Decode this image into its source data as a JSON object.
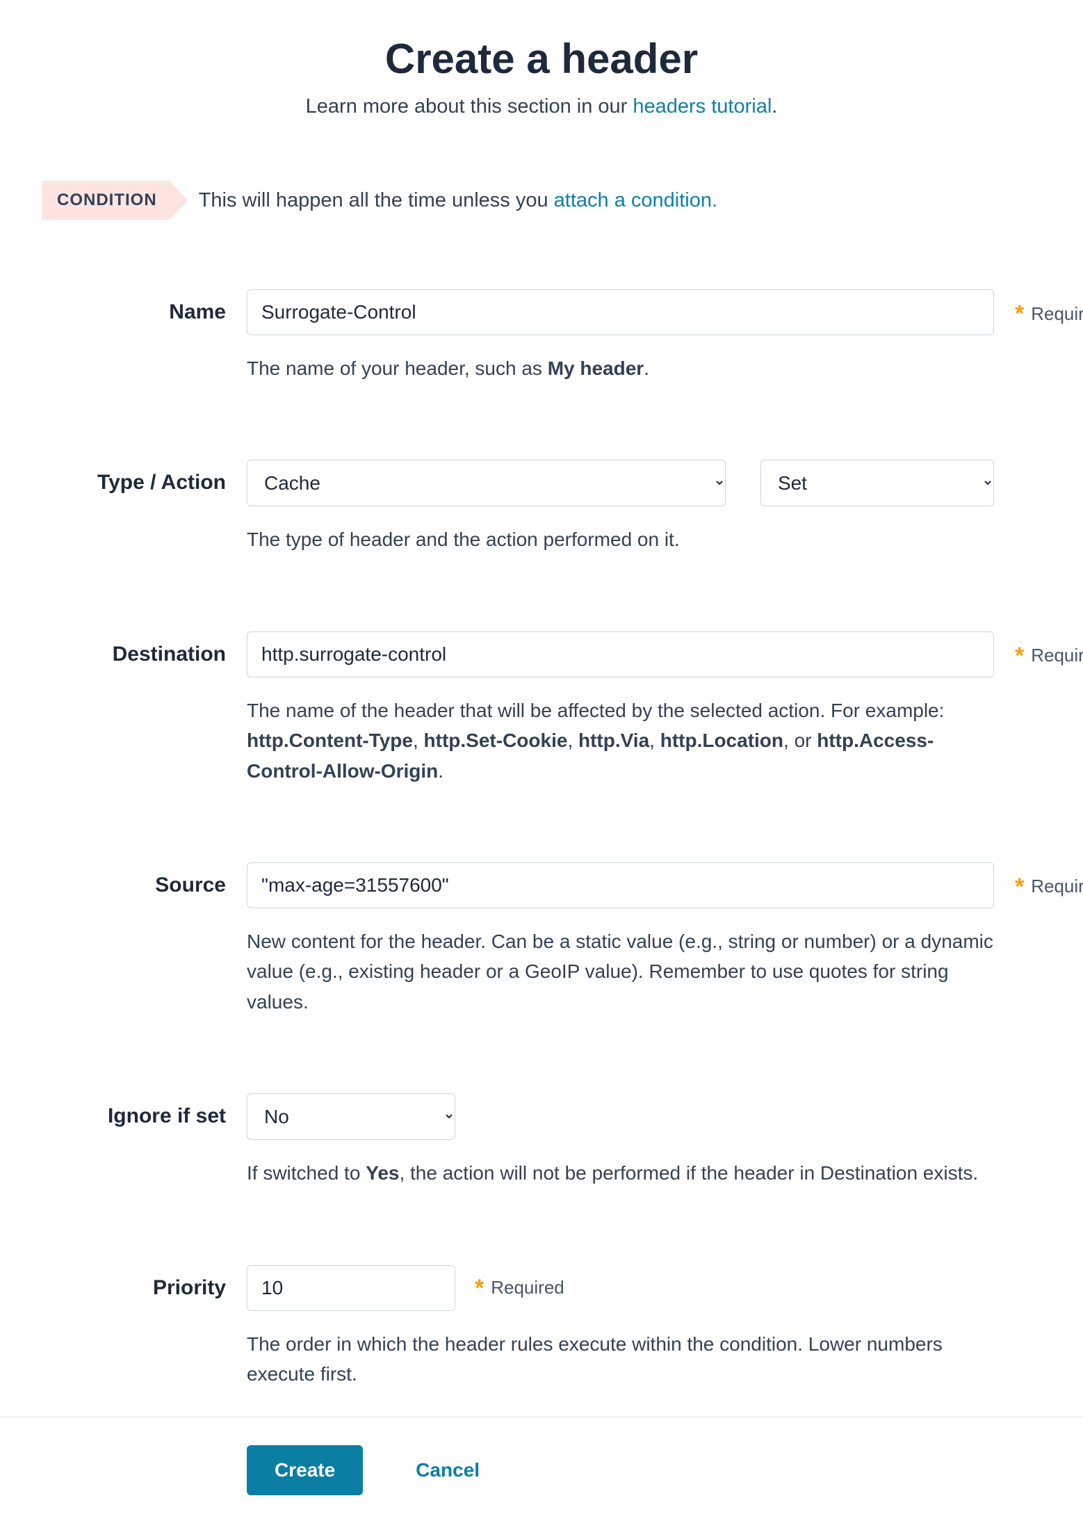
{
  "header": {
    "title": "Create a header",
    "subtitle_prefix": "Learn more about this section in our ",
    "subtitle_link": "headers tutorial",
    "subtitle_suffix": "."
  },
  "condition": {
    "badge": "CONDITION",
    "text_prefix": "This will happen all the time unless you ",
    "link": "attach a condition."
  },
  "required_label": "Required",
  "fields": {
    "name": {
      "label": "Name",
      "value": "Surrogate-Control",
      "help_prefix": "The name of your header, such as ",
      "help_bold": "My header",
      "help_suffix": "."
    },
    "type_action": {
      "label": "Type / Action",
      "type_value": "Cache",
      "action_value": "Set",
      "help": "The type of header and the action performed on it."
    },
    "destination": {
      "label": "Destination",
      "value": "http.surrogate-control",
      "help_prefix": "The name of the header that will be affected by the selected action. For example: ",
      "examples": [
        "http.Content-Type",
        "http.Set-Cookie",
        "http.Via",
        "http.Location"
      ],
      "join": ", ",
      "or": ", or ",
      "last": "http.Access-Control-Allow-Origin",
      "help_suffix": "."
    },
    "source": {
      "label": "Source",
      "value": "\"max-age=31557600\"",
      "help": "New content for the header. Can be a static value (e.g., string or number) or a dynamic value (e.g., existing header or a GeoIP value). Remember to use quotes for string values."
    },
    "ignore": {
      "label": "Ignore if set",
      "value": "No",
      "help_prefix": "If switched to ",
      "help_bold": "Yes",
      "help_suffix": ", the action will not be performed if the header in Destination exists."
    },
    "priority": {
      "label": "Priority",
      "value": "10",
      "help": "The order in which the header rules execute within the condition. Lower numbers execute first."
    }
  },
  "actions": {
    "create": "Create",
    "cancel": "Cancel"
  }
}
